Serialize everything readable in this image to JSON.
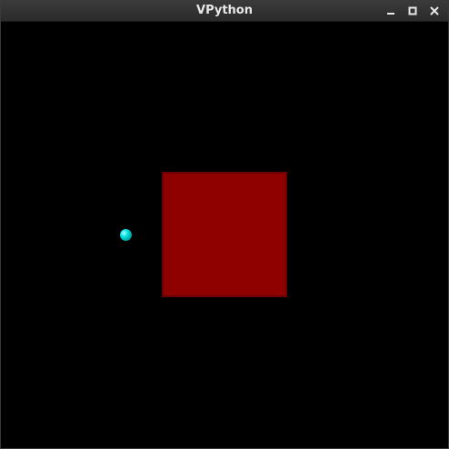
{
  "window": {
    "title": "VPython",
    "controls": {
      "minimize_icon": "minimize-icon",
      "maximize_icon": "maximize-icon",
      "close_icon": "close-icon"
    }
  },
  "scene": {
    "background_color": "#000000",
    "objects": [
      {
        "kind": "box",
        "color": "#8f0000"
      },
      {
        "kind": "sphere",
        "color": "#00e0e0"
      }
    ]
  }
}
